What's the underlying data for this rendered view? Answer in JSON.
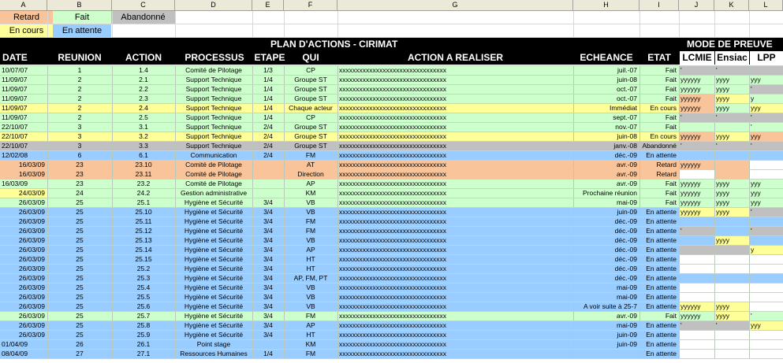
{
  "column_letters": [
    "A",
    "B",
    "C",
    "D",
    "E",
    "F",
    "G",
    "H",
    "I",
    "J",
    "K",
    "L"
  ],
  "colors": {
    "Retard": "#f9c49a",
    "Fait": "#ccffcc",
    "Abandonne": "#c0c0c0",
    "EnCours": "#ffff99",
    "EnAttente": "#99ccff",
    "white": "#ffffff",
    "header_bg": "#000000"
  },
  "legend": {
    "retard": "Retard",
    "fait": "Fait",
    "abandonne": "Abandonné",
    "en_cours": "En cours",
    "en_attente": "En attente"
  },
  "title": "PLAN D'ACTIONS - CIRIMAT",
  "mode_preuve": "MODE DE PREUVE",
  "headers": {
    "date": "DATE",
    "reunion": "REUNION",
    "action": "ACTION",
    "processus": "PROCESSUS",
    "etape": "ETAPE",
    "qui": "QUI",
    "action_a_realiser": "ACTION A REALISER",
    "echeance": "ECHEANCE",
    "etat": "ETAT",
    "lcmie": "LCMIE",
    "ensiac": "Ensiac",
    "lpp": "LPP"
  },
  "rows": [
    {
      "status": "Fait",
      "dateCol": "Fait",
      "dateAlign": "l",
      "date": "10/07/07",
      "reunion": "1",
      "action": "1.4",
      "processus": "Comité de Pilotage",
      "etape": "1/3",
      "qui": "CP",
      "echeance": "juil.-07",
      "etat": "Fait",
      "j": {
        "t": "'",
        "c": "Abandonne"
      },
      "k": {
        "t": "'",
        "c": "Abandonne"
      },
      "l": {
        "t": "",
        "c": "Abandonne"
      }
    },
    {
      "status": "Fait",
      "dateCol": "Fait",
      "dateAlign": "l",
      "date": "11/09/07",
      "reunion": "2",
      "action": "2.1",
      "processus": "Support Technique",
      "etape": "1/4",
      "qui": "Groupe ST",
      "echeance": "juin-08",
      "etat": "Fait",
      "j": {
        "t": "yyyyyy",
        "c": "Fait"
      },
      "k": {
        "t": "yyyy",
        "c": "Fait"
      },
      "l": {
        "t": "yyy",
        "c": "Fait"
      }
    },
    {
      "status": "Fait",
      "dateCol": "Fait",
      "dateAlign": "l",
      "date": "11/09/07",
      "reunion": "2",
      "action": "2.2",
      "processus": "Support Technique",
      "etape": "1/4",
      "qui": "Groupe ST",
      "echeance": "oct.-07",
      "etat": "Fait",
      "j": {
        "t": "yyyyyy",
        "c": "Fait"
      },
      "k": {
        "t": "yyyy",
        "c": "Fait"
      },
      "l": {
        "t": "'",
        "c": "Abandonne"
      }
    },
    {
      "status": "Fait",
      "dateCol": "Fait",
      "dateAlign": "l",
      "date": "11/09/07",
      "reunion": "2",
      "action": "2.3",
      "processus": "Support Technique",
      "etape": "1/4",
      "qui": "Groupe ST",
      "echeance": "oct.-07",
      "etat": "Fait",
      "j": {
        "t": "yyyyyy",
        "c": "Retard"
      },
      "k": {
        "t": "yyyy",
        "c": "EnCours"
      },
      "l": {
        "t": "y",
        "c": "Fait"
      }
    },
    {
      "status": "EnCours",
      "dateCol": "EnCours",
      "dateAlign": "l",
      "date": "11/09/07",
      "reunion": "2",
      "action": "2.4",
      "processus": "Support Technique",
      "etape": "1/4",
      "qui": "Chaque acteur",
      "echeance": "Immédiat",
      "etat": "En cours",
      "j": {
        "t": "yyyyyy",
        "c": "Retard"
      },
      "k": {
        "t": "yyyy",
        "c": "Fait"
      },
      "l": {
        "t": "yyy",
        "c": "EnCours"
      }
    },
    {
      "status": "Fait",
      "dateCol": "Fait",
      "dateAlign": "l",
      "date": "11/09/07",
      "reunion": "2",
      "action": "2.5",
      "processus": "Support Technique",
      "etape": "1/4",
      "qui": "CP",
      "echeance": "sept.-07",
      "etat": "Fait",
      "j": {
        "t": "'",
        "c": "Abandonne"
      },
      "k": {
        "t": "'",
        "c": "Abandonne"
      },
      "l": {
        "t": "'",
        "c": "Abandonne"
      }
    },
    {
      "status": "Fait",
      "dateCol": "Fait",
      "dateAlign": "l",
      "date": "22/10/07",
      "reunion": "3",
      "action": "3.1",
      "processus": "Support Technique",
      "etape": "2/4",
      "qui": "Groupe ST",
      "echeance": "nov.-07",
      "etat": "Fait",
      "j": {
        "t": "",
        "c": "Fait"
      },
      "k": {
        "t": "",
        "c": "Fait"
      },
      "l": {
        "t": "'",
        "c": "Fait"
      }
    },
    {
      "status": "EnCours",
      "dateCol": "EnCours",
      "dateAlign": "l",
      "date": "22/10/07",
      "reunion": "3",
      "action": "3.2",
      "processus": "Support Technique",
      "etape": "2/4",
      "qui": "Groupe ST",
      "echeance": "juin-08",
      "etat": "En cours",
      "j": {
        "t": "yyyyyy",
        "c": "Retard"
      },
      "k": {
        "t": "yyyy",
        "c": "EnCours"
      },
      "l": {
        "t": "yyy",
        "c": "Retard"
      }
    },
    {
      "status": "Abandonne",
      "dateCol": "Abandonne",
      "dateAlign": "l",
      "date": "22/10/07",
      "reunion": "3",
      "action": "3.3",
      "processus": "Support Technique",
      "etape": "2/4",
      "qui": "Groupe ST",
      "echeance": "janv.-08",
      "etat": "Abandonné",
      "j": {
        "t": "'",
        "c": "Abandonne"
      },
      "k": {
        "t": "'",
        "c": "Abandonne"
      },
      "l": {
        "t": "'",
        "c": "Abandonne"
      }
    },
    {
      "status": "EnAttente",
      "dateCol": "EnAttente",
      "dateAlign": "l",
      "date": "12/02/08",
      "reunion": "6",
      "action": "6.1",
      "processus": "Communication",
      "etape": "2/4",
      "qui": "FM",
      "echeance": "déc.-09",
      "etat": "En attente",
      "j": {
        "t": "",
        "c": "EnAttente"
      },
      "k": {
        "t": "",
        "c": "EnAttente"
      },
      "l": {
        "t": "",
        "c": "EnAttente"
      }
    },
    {
      "status": "Retard",
      "dateCol": "Retard",
      "dateAlign": "r",
      "date": "16/03/09",
      "reunion": "23",
      "action": "23.10",
      "processus": "Comité de Pilotage",
      "etape": "",
      "qui": "AT",
      "echeance": "avr.-09",
      "etat": "Retard",
      "j": {
        "t": "yyyyyy",
        "c": "Retard"
      },
      "k": {
        "t": "",
        "c": "Retard"
      },
      "l": {
        "t": "",
        "c": "white"
      }
    },
    {
      "status": "Retard",
      "dateCol": "Retard",
      "dateAlign": "r",
      "date": "16/03/09",
      "reunion": "23",
      "action": "23.11",
      "processus": "Comité de Pilotage",
      "etape": "",
      "qui": "Direction",
      "echeance": "avr.-09",
      "etat": "Retard",
      "j": {
        "t": "",
        "c": "white"
      },
      "k": {
        "t": "",
        "c": "Retard"
      },
      "l": {
        "t": "",
        "c": "white"
      }
    },
    {
      "status": "Fait",
      "dateCol": "Fait",
      "dateAlign": "l",
      "date": "16/03/09",
      "reunion": "23",
      "action": "23.2",
      "processus": "Comité de Pilotage",
      "etape": "",
      "qui": "AP",
      "echeance": "avr.-09",
      "etat": "Fait",
      "j": {
        "t": "yyyyyy",
        "c": "Fait"
      },
      "k": {
        "t": "yyyy",
        "c": "Fait"
      },
      "l": {
        "t": "yyy",
        "c": "Fait"
      }
    },
    {
      "status": "Fait",
      "dateCol": "EnCours",
      "dateAlign": "r",
      "date": "24/03/09",
      "reunion": "24",
      "action": "24.2",
      "processus": "Gestion administrative",
      "etape": "",
      "qui": "KM",
      "echeance": "Prochaine réunion",
      "etat": "Fait",
      "j": {
        "t": "yyyyyy",
        "c": "Fait"
      },
      "k": {
        "t": "yyyy",
        "c": "Fait"
      },
      "l": {
        "t": "yyy",
        "c": "Fait"
      }
    },
    {
      "status": "Fait",
      "dateCol": "Fait",
      "dateAlign": "r",
      "date": "26/03/09",
      "reunion": "25",
      "action": "25.1",
      "processus": "Hygiène et Sécurité",
      "etape": "3/4",
      "qui": "VB",
      "echeance": "mai-09",
      "etat": "Fait",
      "j": {
        "t": "yyyyyy",
        "c": "Fait"
      },
      "k": {
        "t": "yyyy",
        "c": "Fait"
      },
      "l": {
        "t": "yyy",
        "c": "Fait"
      }
    },
    {
      "status": "EnAttente",
      "dateCol": "EnAttente",
      "dateAlign": "r",
      "date": "26/03/09",
      "reunion": "25",
      "action": "25.10",
      "processus": "Hygiène et Sécurité",
      "etape": "3/4",
      "qui": "VB",
      "echeance": "juin-09",
      "etat": "En attente",
      "j": {
        "t": "yyyyyy",
        "c": "EnCours"
      },
      "k": {
        "t": "yyyy",
        "c": "EnCours"
      },
      "l": {
        "t": "'",
        "c": "Abandonne"
      }
    },
    {
      "status": "EnAttente",
      "dateCol": "EnAttente",
      "dateAlign": "r",
      "date": "26/03/09",
      "reunion": "25",
      "action": "25.11",
      "processus": "Hygiène et Sécurité",
      "etape": "3/4",
      "qui": "FM",
      "echeance": "déc.-09",
      "etat": "En attente",
      "j": {
        "t": "",
        "c": "EnAttente"
      },
      "k": {
        "t": "",
        "c": "EnAttente"
      },
      "l": {
        "t": "",
        "c": "EnAttente"
      }
    },
    {
      "status": "EnAttente",
      "dateCol": "EnAttente",
      "dateAlign": "r",
      "date": "26/03/09",
      "reunion": "25",
      "action": "25.12",
      "processus": "Hygiène et Sécurité",
      "etape": "3/4",
      "qui": "FM",
      "echeance": "déc.-09",
      "etat": "En attente",
      "j": {
        "t": "'",
        "c": "Abandonne"
      },
      "k": {
        "t": "",
        "c": "EnAttente"
      },
      "l": {
        "t": "'",
        "c": "Abandonne"
      }
    },
    {
      "status": "EnAttente",
      "dateCol": "EnAttente",
      "dateAlign": "r",
      "date": "26/03/09",
      "reunion": "25",
      "action": "25.13",
      "processus": "Hygiène et Sécurité",
      "etape": "3/4",
      "qui": "VB",
      "echeance": "déc.-09",
      "etat": "En attente",
      "j": {
        "t": "",
        "c": "EnAttente"
      },
      "k": {
        "t": "yyyy",
        "c": "EnCours"
      },
      "l": {
        "t": "",
        "c": "EnAttente"
      }
    },
    {
      "status": "EnAttente",
      "dateCol": "EnAttente",
      "dateAlign": "r",
      "date": "26/03/09",
      "reunion": "25",
      "action": "25.14",
      "processus": "Hygiène et Sécurité",
      "etape": "3/4",
      "qui": "AP",
      "echeance": "déc.-09",
      "etat": "En attente",
      "j": {
        "t": "",
        "c": "Abandonne"
      },
      "k": {
        "t": "",
        "c": "Abandonne"
      },
      "l": {
        "t": "y",
        "c": "EnCours"
      }
    },
    {
      "status": "EnAttente",
      "dateCol": "EnAttente",
      "dateAlign": "r",
      "date": "26/03/09",
      "reunion": "25",
      "action": "25.15",
      "processus": "Hygiène et Sécurité",
      "etape": "3/4",
      "qui": "HT",
      "echeance": "déc.-09",
      "etat": "En attente",
      "j": {
        "t": "",
        "c": "white"
      },
      "k": {
        "t": "",
        "c": "white"
      },
      "l": {
        "t": "",
        "c": "white"
      }
    },
    {
      "status": "EnAttente",
      "dateCol": "EnAttente",
      "dateAlign": "r",
      "date": "26/03/09",
      "reunion": "25",
      "action": "25.2",
      "processus": "Hygiène et Sécurité",
      "etape": "3/4",
      "qui": "HT",
      "echeance": "déc.-09",
      "etat": "En attente",
      "j": {
        "t": "",
        "c": "white"
      },
      "k": {
        "t": "",
        "c": "white"
      },
      "l": {
        "t": "",
        "c": "white"
      }
    },
    {
      "status": "EnAttente",
      "dateCol": "EnAttente",
      "dateAlign": "r",
      "date": "26/03/09",
      "reunion": "25",
      "action": "25.3",
      "processus": "Hygiène et Sécurité",
      "etape": "3/4",
      "qui": "AP, FM, PT",
      "echeance": "déc.-09",
      "etat": "En attente",
      "j": {
        "t": "",
        "c": "EnAttente"
      },
      "k": {
        "t": "",
        "c": "EnAttente"
      },
      "l": {
        "t": "",
        "c": "EnAttente"
      }
    },
    {
      "status": "EnAttente",
      "dateCol": "EnAttente",
      "dateAlign": "r",
      "date": "26/03/09",
      "reunion": "25",
      "action": "25.4",
      "processus": "Hygiène et Sécurité",
      "etape": "3/4",
      "qui": "VB",
      "echeance": "mai-09",
      "etat": "En attente",
      "j": {
        "t": "",
        "c": "white"
      },
      "k": {
        "t": "",
        "c": "white"
      },
      "l": {
        "t": "",
        "c": "white"
      }
    },
    {
      "status": "EnAttente",
      "dateCol": "EnAttente",
      "dateAlign": "r",
      "date": "26/03/09",
      "reunion": "25",
      "action": "25.5",
      "processus": "Hygiène et Sécurité",
      "etape": "3/4",
      "qui": "VB",
      "echeance": "mai-09",
      "etat": "En attente",
      "j": {
        "t": "",
        "c": "white"
      },
      "k": {
        "t": "",
        "c": "white"
      },
      "l": {
        "t": "",
        "c": "white"
      }
    },
    {
      "status": "EnAttente",
      "dateCol": "EnAttente",
      "dateAlign": "r",
      "date": "26/03/09",
      "reunion": "25",
      "action": "25.6",
      "processus": "Hygiène et Sécurité",
      "etape": "3/4",
      "qui": "VB",
      "echeance": "A voir suite à 25-7",
      "etat": "En attente",
      "j": {
        "t": "yyyyyy",
        "c": "EnCours"
      },
      "k": {
        "t": "yyyy",
        "c": "EnCours"
      },
      "l": {
        "t": "",
        "c": "white"
      }
    },
    {
      "status": "Fait",
      "dateCol": "Fait",
      "dateAlign": "r",
      "date": "26/03/09",
      "reunion": "25",
      "action": "25.7",
      "processus": "Hygiène et Sécurité",
      "etape": "3/4",
      "qui": "FM",
      "echeance": "avr.-09",
      "etat": "Fait",
      "j": {
        "t": "yyyyyy",
        "c": "Fait"
      },
      "k": {
        "t": "yyyy",
        "c": "EnCours"
      },
      "l": {
        "t": "'",
        "c": "Fait"
      }
    },
    {
      "status": "EnAttente",
      "dateCol": "EnAttente",
      "dateAlign": "r",
      "date": "26/03/09",
      "reunion": "25",
      "action": "25.8",
      "processus": "Hygiène et Sécurité",
      "etape": "3/4",
      "qui": "AP",
      "echeance": "mai-09",
      "etat": "En attente",
      "j": {
        "t": "'",
        "c": "Abandonne"
      },
      "k": {
        "t": "'",
        "c": "Abandonne"
      },
      "l": {
        "t": "yyy",
        "c": "EnCours"
      }
    },
    {
      "status": "EnAttente",
      "dateCol": "EnAttente",
      "dateAlign": "r",
      "date": "26/03/09",
      "reunion": "25",
      "action": "25.9",
      "processus": "Hygiène et Sécurité",
      "etape": "3/4",
      "qui": "HT",
      "echeance": "juin-09",
      "etat": "En attente",
      "j": {
        "t": "",
        "c": "white"
      },
      "k": {
        "t": "",
        "c": "white"
      },
      "l": {
        "t": "",
        "c": "white"
      }
    },
    {
      "status": "EnAttente",
      "dateCol": "EnAttente",
      "dateAlign": "l",
      "date": "01/04/09",
      "reunion": "26",
      "action": "26.1",
      "processus": "Point stage",
      "etape": "",
      "qui": "KM",
      "echeance": "juin-09",
      "etat": "En attente",
      "j": {
        "t": "",
        "c": "white"
      },
      "k": {
        "t": "",
        "c": "white"
      },
      "l": {
        "t": "",
        "c": "white"
      }
    },
    {
      "status": "EnAttente",
      "dateCol": "EnAttente",
      "dateAlign": "l",
      "date": "08/04/09",
      "reunion": "27",
      "action": "27.1",
      "processus": "Ressources Humaines",
      "etape": "1/4",
      "qui": "FM",
      "echeance": "",
      "etat": "En attente",
      "j": {
        "t": "",
        "c": "white"
      },
      "k": {
        "t": "",
        "c": "white"
      },
      "l": {
        "t": "",
        "c": "white"
      }
    }
  ],
  "action_placeholder": "xxxxxxxxxxxxxxxxxxxxxxxxxxxxxxxx"
}
